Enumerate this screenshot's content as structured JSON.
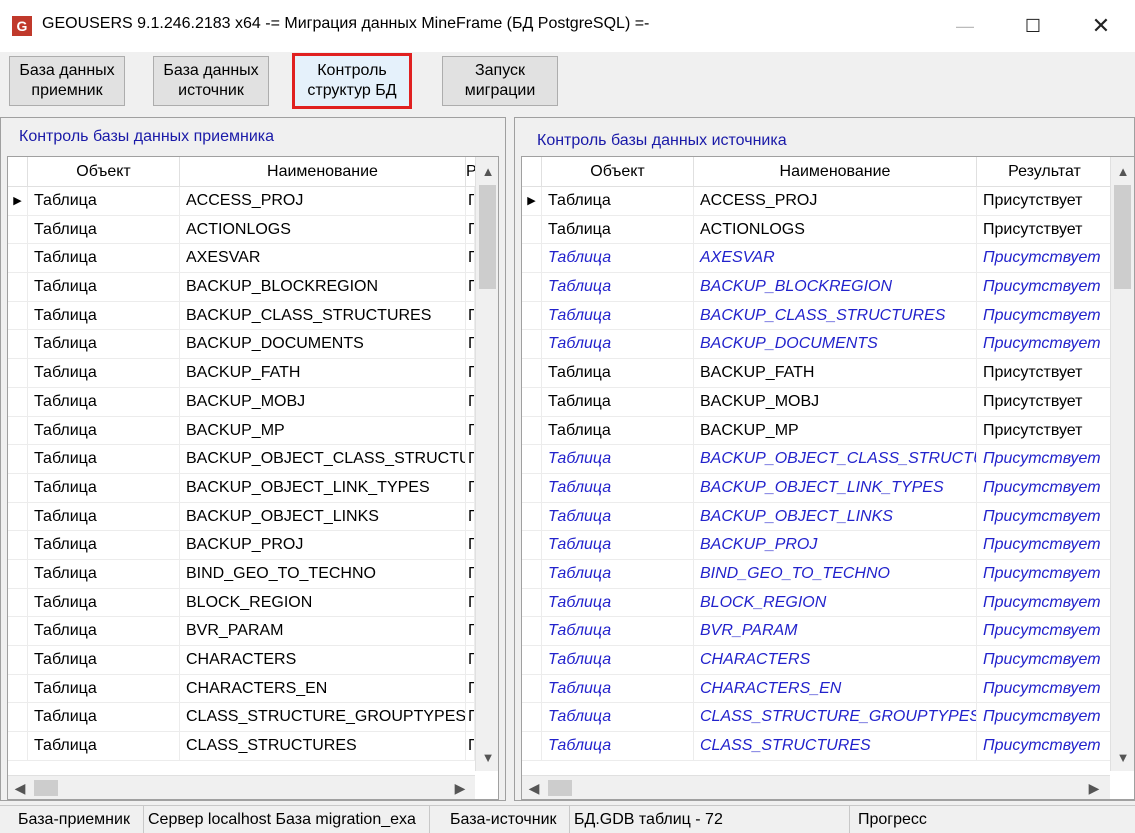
{
  "window": {
    "icon_label": "G",
    "title": "GEOUSERS 9.1.246.2183 x64  -=  Миграция данных MineFrame (БД PostgreSQL) =-",
    "minimize": "—",
    "maximize": "☐",
    "close": "✕"
  },
  "toolbar": {
    "btn_target": "База данных\nприемник",
    "btn_source": "База данных\nисточник",
    "btn_control": "Контроль\nструктур БД",
    "btn_run": "Запуск\nмиграции"
  },
  "left_panel": {
    "title": "Контроль базы данных приемника",
    "columns": [
      "Объект",
      "Наименование",
      "Р"
    ],
    "rows": [
      {
        "object": "Таблица",
        "name": "ACCESS_PROJ",
        "result": "П",
        "current": true
      },
      {
        "object": "Таблица",
        "name": "ACTIONLOGS",
        "result": "П"
      },
      {
        "object": "Таблица",
        "name": "AXESVAR",
        "result": "П"
      },
      {
        "object": "Таблица",
        "name": "BACKUP_BLOCKREGION",
        "result": "П"
      },
      {
        "object": "Таблица",
        "name": "BACKUP_CLASS_STRUCTURES",
        "result": "П"
      },
      {
        "object": "Таблица",
        "name": "BACKUP_DOCUMENTS",
        "result": "П"
      },
      {
        "object": "Таблица",
        "name": "BACKUP_FATH",
        "result": "П"
      },
      {
        "object": "Таблица",
        "name": "BACKUP_MOBJ",
        "result": "П"
      },
      {
        "object": "Таблица",
        "name": "BACKUP_MP",
        "result": "П"
      },
      {
        "object": "Таблица",
        "name": "BACKUP_OBJECT_CLASS_STRUCTURES",
        "result": "П"
      },
      {
        "object": "Таблица",
        "name": "BACKUP_OBJECT_LINK_TYPES",
        "result": "П"
      },
      {
        "object": "Таблица",
        "name": "BACKUP_OBJECT_LINKS",
        "result": "П"
      },
      {
        "object": "Таблица",
        "name": "BACKUP_PROJ",
        "result": "П"
      },
      {
        "object": "Таблица",
        "name": "BIND_GEO_TO_TECHNO",
        "result": "П"
      },
      {
        "object": "Таблица",
        "name": "BLOCK_REGION",
        "result": "П"
      },
      {
        "object": "Таблица",
        "name": "BVR_PARAM",
        "result": "П"
      },
      {
        "object": "Таблица",
        "name": "CHARACTERS",
        "result": "П"
      },
      {
        "object": "Таблица",
        "name": "CHARACTERS_EN",
        "result": "П"
      },
      {
        "object": "Таблица",
        "name": "CLASS_STRUCTURE_GROUPTYPES",
        "result": "П"
      },
      {
        "object": "Таблица",
        "name": "CLASS_STRUCTURES",
        "result": "П"
      }
    ]
  },
  "right_panel": {
    "title": "Контроль базы данных источника",
    "columns": [
      "Объект",
      "Наименование",
      "Результат"
    ],
    "rows": [
      {
        "object": "Таблица",
        "name": "ACCESS_PROJ",
        "result": "Присутствует",
        "current": true
      },
      {
        "object": "Таблица",
        "name": "ACTIONLOGS",
        "result": "Присутствует"
      },
      {
        "object": "Таблица",
        "name": "AXESVAR",
        "result": "Присутствует",
        "italic": true
      },
      {
        "object": "Таблица",
        "name": "BACKUP_BLOCKREGION",
        "result": "Присутствует",
        "italic": true
      },
      {
        "object": "Таблица",
        "name": "BACKUP_CLASS_STRUCTURES",
        "result": "Присутствует",
        "italic": true
      },
      {
        "object": "Таблица",
        "name": "BACKUP_DOCUMENTS",
        "result": "Присутствует",
        "italic": true
      },
      {
        "object": "Таблица",
        "name": "BACKUP_FATH",
        "result": "Присутствует"
      },
      {
        "object": "Таблица",
        "name": "BACKUP_MOBJ",
        "result": "Присутствует"
      },
      {
        "object": "Таблица",
        "name": "BACKUP_MP",
        "result": "Присутствует"
      },
      {
        "object": "Таблица",
        "name": "BACKUP_OBJECT_CLASS_STRUCTURES",
        "result": "Присутствует",
        "italic": true
      },
      {
        "object": "Таблица",
        "name": "BACKUP_OBJECT_LINK_TYPES",
        "result": "Присутствует",
        "italic": true
      },
      {
        "object": "Таблица",
        "name": "BACKUP_OBJECT_LINKS",
        "result": "Присутствует",
        "italic": true
      },
      {
        "object": "Таблица",
        "name": "BACKUP_PROJ",
        "result": "Присутствует",
        "italic": true
      },
      {
        "object": "Таблица",
        "name": "BIND_GEO_TO_TECHNO",
        "result": "Присутствует",
        "italic": true
      },
      {
        "object": "Таблица",
        "name": "BLOCK_REGION",
        "result": "Присутствует",
        "italic": true
      },
      {
        "object": "Таблица",
        "name": "BVR_PARAM",
        "result": "Присутствует",
        "italic": true
      },
      {
        "object": "Таблица",
        "name": "CHARACTERS",
        "result": "Присутствует",
        "italic": true
      },
      {
        "object": "Таблица",
        "name": "CHARACTERS_EN",
        "result": "Присутствует",
        "italic": true
      },
      {
        "object": "Таблица",
        "name": "CLASS_STRUCTURE_GROUPTYPES",
        "result": "Присутствует",
        "italic": true
      },
      {
        "object": "Таблица",
        "name": "CLASS_STRUCTURES",
        "result": "Присутствует",
        "italic": true
      }
    ]
  },
  "statusbar": {
    "target_label": "База-приемник",
    "target_info": "Сервер localhost База migration_exa",
    "source_label": "База-источник",
    "source_info": "БД.GDB таблиц - 72",
    "progress_label": "Прогресс"
  },
  "colors": {
    "italic_row": "#2222cc",
    "panel_title": "#1a1aa8",
    "active_button_border": "#e02020"
  }
}
